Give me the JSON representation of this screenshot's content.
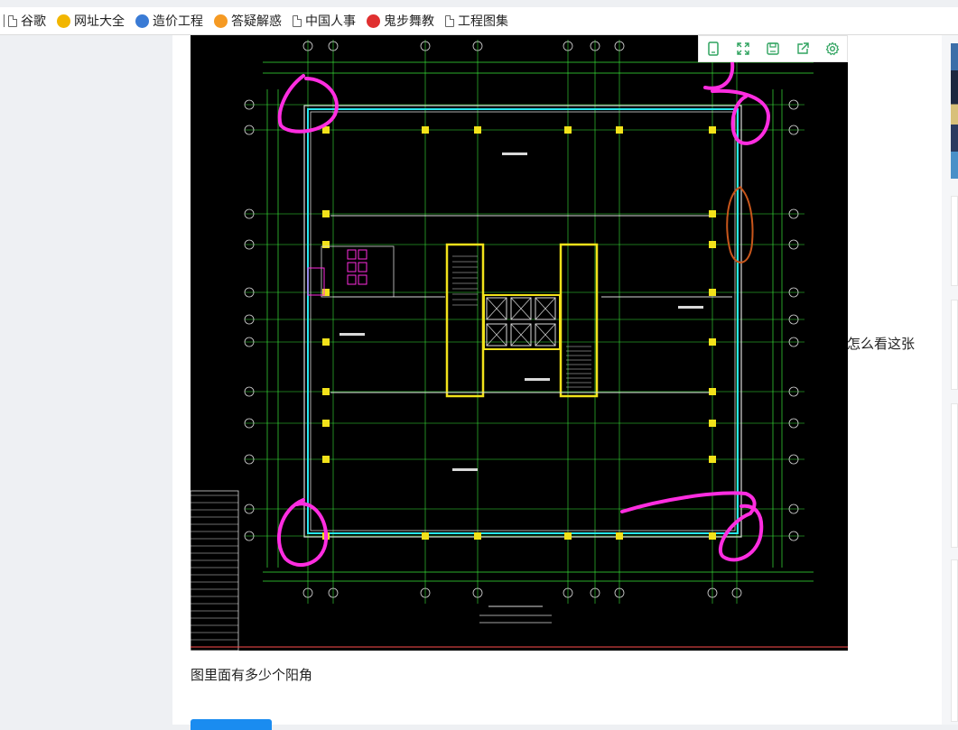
{
  "bookmarks": [
    {
      "label": "谷歌",
      "icon": "page-icon"
    },
    {
      "label": "网址大全",
      "icon": "plus-globe-icon",
      "color": "#f2b600"
    },
    {
      "label": "造价工程",
      "icon": "z-logo-icon",
      "color": "#3a7bd5"
    },
    {
      "label": "答疑解惑",
      "icon": "question-logo-icon",
      "color": "#f59a23"
    },
    {
      "label": "中国人事",
      "icon": "page-icon"
    },
    {
      "label": "鬼步舞教",
      "icon": "ribbon-logo-icon",
      "color": "#e03030"
    },
    {
      "label": "工程图集",
      "icon": "page-icon"
    }
  ],
  "image_toolbar": [
    {
      "name": "fit-screen-icon"
    },
    {
      "name": "fullscreen-icon"
    },
    {
      "name": "save-icon"
    },
    {
      "name": "share-icon"
    },
    {
      "name": "settings-icon"
    }
  ],
  "post": {
    "question_text": "图里面有多少个阳角",
    "side_text": "怎么看这张"
  },
  "colors": {
    "accent": "#1a8cf0",
    "toolbar_icon": "#2fa35f",
    "cad_background": "#000000",
    "annotation_magenta": "#ff2de0",
    "annotation_orange": "#c8561b"
  }
}
